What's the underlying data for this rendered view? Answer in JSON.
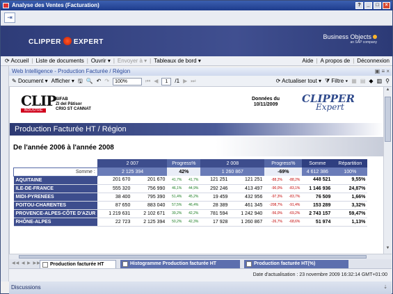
{
  "window": {
    "title": "Analyse des Ventes (Facturation)"
  },
  "banner": {
    "logo": "CLIPPER  EXPERT",
    "bo_brand": "Business Objects",
    "bo_sub": "an SAP company"
  },
  "nav": {
    "accueil": "Accueil",
    "liste": "Liste de documents",
    "ouvrir": "Ouvrir ▾",
    "envoyer": "Envoyer à ▾",
    "tableaux": "Tableaux de bord ▾",
    "aide": "Aide",
    "apropos": "A propos de",
    "deconnexion": "Déconnexion"
  },
  "wi": {
    "title": "Web Intelligence - Production Facturée / Région"
  },
  "toolbar": {
    "document": "Document ▾",
    "afficher": "Afficher ▾",
    "zoom": "100%",
    "page": "1",
    "page_of": "/1",
    "actualiser": "Actualiser tout ▾",
    "filtre": "Filtre ▾"
  },
  "report": {
    "clip_logo": "CLIP",
    "clip_industrie": "INDUSTRIE",
    "company_line1": "SIFAB",
    "company_line2": "ZI del Pâtisor",
    "company_line3": "CRIO ST CANNAT",
    "donnees_label": "Données du",
    "donnees_date": "10/11/2009",
    "clipper_logo": "CLIPPER",
    "clipper_expert": "Expert",
    "title": "Production Facturée HT / Région",
    "period": "De l'année 2006 à l'année 2008"
  },
  "table": {
    "h_2007": "2 007",
    "h_prog1": "Progress%",
    "h_2008": "2 008",
    "h_prog2": "Progress%",
    "h_somme": "Somme",
    "h_repartition": "Répartition",
    "somme_label": "Somme :",
    "s_2007": "2 125 394",
    "s_prog1": "42%",
    "s_2008": "1 260 867",
    "s_prog2": "-69%",
    "s_somme": "4 612 386",
    "s_rep": "100%",
    "rows": [
      {
        "region": "AQUITAINE",
        "a": "201 670",
        "b": "201 670",
        "p1": "41,7%",
        "p2": "41,7%",
        "c": "121 251",
        "d": "121 251",
        "p3": "-88,2%",
        "p4": "-88,2%",
        "somme": "448 521",
        "rep": "9,55%"
      },
      {
        "region": "ILE-DE-FRANCE",
        "a": "555 320",
        "b": "756 990",
        "p1": "46,1%",
        "p2": "44,9%",
        "c": "292 246",
        "d": "413 497",
        "p3": "-90,0%",
        "p4": "-83,1%",
        "somme": "1 146 936",
        "rep": "24,87%"
      },
      {
        "region": "MIDI-PYRENEES",
        "a": "38 400",
        "b": "795 390",
        "p1": "51,4%",
        "p2": "45,2%",
        "c": "19 459",
        "d": "432 956",
        "p3": "-97,3%",
        "p4": "-83,7%",
        "somme": "76 509",
        "rep": "1,66%"
      },
      {
        "region": "POITOU-CHARENTES",
        "a": "87 650",
        "b": "883 040",
        "p1": "57,5%",
        "p2": "46,4%",
        "c": "28 389",
        "d": "461 345",
        "p3": "-208,7%",
        "p4": "-91,4%",
        "somme": "153 289",
        "rep": "3,32%"
      },
      {
        "region": "PROVENCE-ALPES-CÔTE D'AZUR",
        "a": "1 219 631",
        "b": "2 102 671",
        "p1": "39,2%",
        "p2": "42,2%",
        "c": "781 594",
        "d": "1 242 940",
        "p3": "-56,0%",
        "p4": "-69,2%",
        "somme": "2 743 157",
        "rep": "59,47%"
      },
      {
        "region": "RHÔNE-ALPES",
        "a": "22 723",
        "b": "2 125 394",
        "p1": "50,2%",
        "p2": "42,3%",
        "c": "17 928",
        "d": "1 260 867",
        "p3": "-26,7%",
        "p4": "-68,6%",
        "somme": "51 974",
        "rep": "1,13%"
      }
    ]
  },
  "tabs": {
    "t1": "Production facturée HT",
    "t2": "Histogramme Production facturée HT",
    "t3": "Production facturée HT(%)"
  },
  "status": {
    "text": "Date d'actualisation : 23 novembre 2009 16:32:14 GMT+01:00"
  },
  "discussions": {
    "label": "Discussions"
  },
  "colors": {
    "header_blue": "#3d4d8d",
    "positive": "#177a1e",
    "negative": "#c20000"
  }
}
